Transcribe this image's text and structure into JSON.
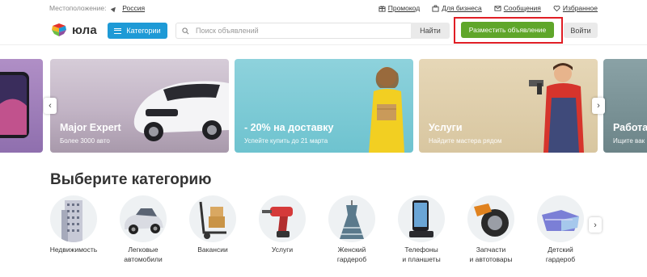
{
  "topbar": {
    "location_label": "Местоположение:",
    "city": "Россия",
    "links": [
      {
        "label": "Промокод",
        "icon": "promo-icon"
      },
      {
        "label": "Для бизнеса",
        "icon": "business-icon"
      },
      {
        "label": "Сообщения",
        "icon": "message-icon"
      },
      {
        "label": "Избранное",
        "icon": "heart-icon"
      }
    ]
  },
  "header": {
    "logo_text": "юла",
    "categories_label": "Категории",
    "search_placeholder": "Поиск объявлений",
    "search_value": "",
    "find_label": "Найти",
    "post_label": "Разместить объявление",
    "login_label": "Войти"
  },
  "banners": [
    {
      "title": "",
      "subtitle": ""
    },
    {
      "title": "Major Expert",
      "subtitle": "Более 3000 авто"
    },
    {
      "title": "- 20% на доставку",
      "subtitle": "Успейте купить до 21 марта"
    },
    {
      "title": "Услуги",
      "subtitle": "Найдите мастера рядом"
    },
    {
      "title": "Работа",
      "subtitle": "Ищите вак"
    }
  ],
  "nav": {
    "prev": "‹",
    "next": "›"
  },
  "categories": {
    "title": "Выберите категорию",
    "items": [
      {
        "label": "Недвижимость",
        "icon": "building-icon"
      },
      {
        "label": "Легковые автомобили",
        "icon": "car-icon"
      },
      {
        "label": "Вакансии",
        "icon": "handcart-icon"
      },
      {
        "label": "Услуги",
        "icon": "drill-icon"
      },
      {
        "label": "Женский гардероб",
        "icon": "dress-icon"
      },
      {
        "label": "Телефоны и планшеты",
        "icon": "phone-icon"
      },
      {
        "label": "Запчасти и автотовары",
        "icon": "tire-icon"
      },
      {
        "label": "Детский гардероб",
        "icon": "kids-clothes-icon"
      }
    ]
  },
  "colors": {
    "accent_blue": "#1e9ad6",
    "post_green": "#5fa62a",
    "highlight_red": "#e01e25"
  }
}
